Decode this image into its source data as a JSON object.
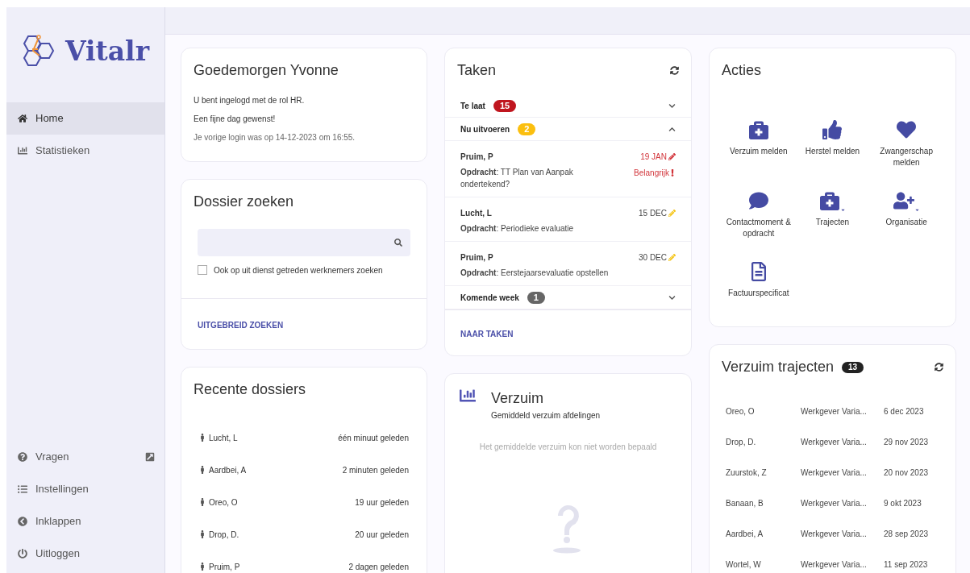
{
  "logo": {
    "text": "Vitalr"
  },
  "sidebar": {
    "items": [
      {
        "label": "Home",
        "kind": "home",
        "selected": true
      },
      {
        "label": "Statistieken",
        "kind": "chart",
        "selected": false
      }
    ],
    "bottom_items": [
      {
        "label": "Vragen",
        "kind": "question",
        "external": true
      },
      {
        "label": "Instellingen",
        "kind": "list",
        "external": false
      },
      {
        "label": "Inklappen",
        "kind": "collapse",
        "external": false
      },
      {
        "label": "Uitloggen",
        "kind": "power",
        "external": false
      }
    ]
  },
  "welcome": {
    "title": "Goedemorgen Yvonne",
    "lines": [
      "U bent ingelogd met de rol HR.",
      "Een fijne dag gewenst!"
    ],
    "last_login": "Je vorige login was op 14-12-2023 om 16:55."
  },
  "dossier_search": {
    "title": "Dossier zoeken",
    "checkbox": {
      "label": "Ook op uit dienst getreden werknemers zoeken",
      "checked": false
    },
    "link": "UITGEBREID ZOEKEN"
  },
  "recent": {
    "title": "Recente dossiers",
    "rows": [
      {
        "name": "Lucht, L",
        "time": "één minuut geleden"
      },
      {
        "name": "Aardbei, A",
        "time": "2 minuten geleden"
      },
      {
        "name": "Oreo, O",
        "time": "19 uur geleden"
      },
      {
        "name": "Drop, D.",
        "time": "20 uur geleden"
      },
      {
        "name": "Pruim, P",
        "time": "2 dagen geleden"
      }
    ]
  },
  "tasks": {
    "title": "Taken",
    "groups": [
      {
        "label": "Te laat",
        "count": "15",
        "color": "#c0161f",
        "expanded": false
      },
      {
        "label": "Nu uitvoeren",
        "count": "2",
        "color": "#fbbf0f",
        "expanded": true,
        "items": [
          {
            "name": "Pruim, P",
            "task": "**Opdracht**: TT Plan van Aanpak ondertekend?",
            "date": "19 JAN",
            "urgent": true,
            "flag": "Belangrijk"
          },
          {
            "name": "Lucht, L",
            "task": "**Opdracht**: Periodieke evaluatie",
            "date": "15 DEC",
            "urgent": false
          },
          {
            "name": "Pruim, P",
            "task": "**Opdracht**: Eerstejaarsevaluatie opstellen",
            "date": "30 DEC",
            "urgent": false
          }
        ]
      },
      {
        "label": "Komende week",
        "count": "1",
        "color": "#666666",
        "expanded": false
      }
    ],
    "link": "NAAR TAKEN"
  },
  "absence": {
    "title": "Verzuim",
    "subtitle": "Gemiddeld verzuim afdelingen",
    "message": "Het gemiddelde verzuim kon niet worden bepaald"
  },
  "actions": {
    "title": "Acties",
    "items": [
      {
        "label": "Verzuim melden",
        "kind": "medical",
        "dropdown": false
      },
      {
        "label": "Herstel melden",
        "kind": "thumb",
        "dropdown": false
      },
      {
        "label": "Zwangerschap melden",
        "kind": "heart",
        "dropdown": false
      },
      {
        "label": "Contactmoment & opdracht",
        "kind": "comment",
        "dropdown": false
      },
      {
        "label": "Trajecten",
        "kind": "medical",
        "dropdown": true
      },
      {
        "label": "Organisatie",
        "kind": "userplus",
        "dropdown": true
      },
      {
        "label": "Factuurspecificat",
        "kind": "file",
        "dropdown": false
      }
    ]
  },
  "trajects": {
    "title": "Verzuim trajecten",
    "count": "13",
    "rows": [
      {
        "name": "Oreo, O",
        "employer": "Werkgever Varia...",
        "date": "6 dec 2023"
      },
      {
        "name": "Drop, D.",
        "employer": "Werkgever Varia...",
        "date": "29 nov 2023"
      },
      {
        "name": "Zuurstok, Z",
        "employer": "Werkgever Varia...",
        "date": "20 nov 2023"
      },
      {
        "name": "Banaan, B",
        "employer": "Werkgever Varia...",
        "date": "9 okt 2023"
      },
      {
        "name": "Aardbei, A",
        "employer": "Werkgever Varia...",
        "date": "28 sep 2023"
      },
      {
        "name": "Wortel, W",
        "employer": "Werkgever Varia...",
        "date": "11 sep 2023"
      }
    ]
  }
}
